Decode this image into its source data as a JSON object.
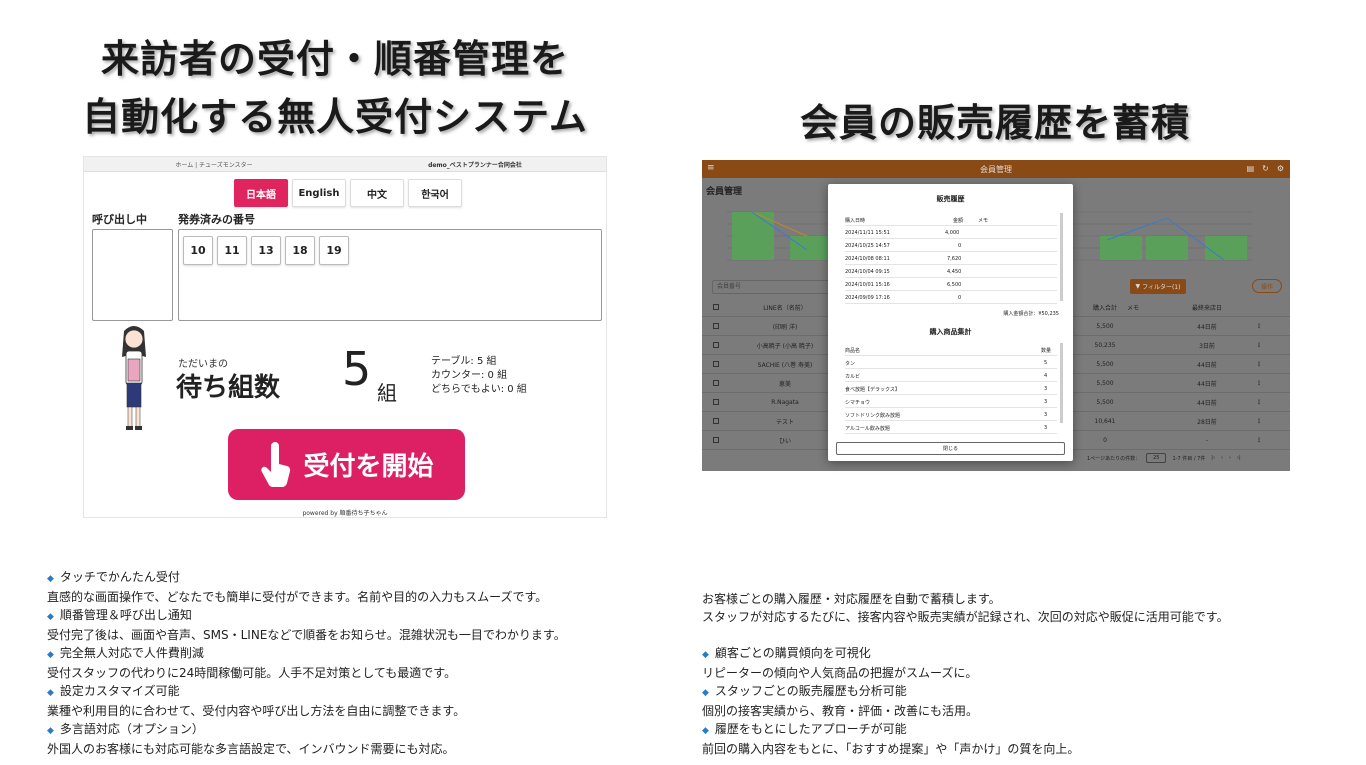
{
  "headings": {
    "left_line1": "来訪者の受付・順番管理を",
    "left_line2": "自動化する無人受付システム",
    "right": "会員の販売履歴を蓄積"
  },
  "kiosk": {
    "tab_home": "ホーム | チューズモンスター",
    "tab_demo": "demo_ベストプランナー合同会社",
    "languages": [
      "日本語",
      "English",
      "中文",
      "한국어"
    ],
    "calling_label": "呼び出し中",
    "issued_label": "発券済みの番号",
    "issued_numbers": [
      "10",
      "11",
      "13",
      "18",
      "19"
    ],
    "wait_sub": "ただいまの",
    "wait_title": "待ち組数",
    "wait_count": "5",
    "wait_unit": "組",
    "detail_table": "テーブル: 5 組",
    "detail_counter": "カウンター: 0 組",
    "detail_any": "どちらでもよい: 0 組",
    "start_button": "受付を開始",
    "powered": "powered by 順番待ち子ちゃん"
  },
  "admin": {
    "bar_title": "会員管理",
    "page_title": "会員管理",
    "search_placeholder": "会員番号",
    "filter_label": "フィルター(1)",
    "ops_label": "操作",
    "table_header": {
      "name": "LINE名（名前）",
      "total": "購入合計",
      "memo": "メモ",
      "last": "最終来店日"
    },
    "rows": [
      {
        "name": "(印刷 洋)",
        "total": "5,500",
        "last": "44日前"
      },
      {
        "name": "小高暁子 (小高 暁子)",
        "total": "50,235",
        "last": "3日前"
      },
      {
        "name": "SACHIE (八巻 寿美)",
        "total": "5,500",
        "last": "44日前"
      },
      {
        "name": "恵美",
        "total": "5,500",
        "last": "44日前"
      },
      {
        "name": "R.Nagata",
        "total": "5,500",
        "last": "44日前"
      },
      {
        "name": "テスト",
        "total": "10,641",
        "last": "28日前"
      },
      {
        "name": "ひい",
        "total": "0",
        "last": "-"
      }
    ],
    "footer_per_page": "1ページあたりの件数：",
    "footer_pp_value": "25",
    "footer_range": "1-7 件目 / 7件"
  },
  "modal": {
    "title": "販売履歴",
    "hist_header": {
      "date": "購入日時",
      "amount": "金額",
      "memo": "メモ"
    },
    "hist_rows": [
      {
        "date": "2024/11/11 15:51",
        "amount": "4,000"
      },
      {
        "date": "2024/10/25 14:57",
        "amount": "0"
      },
      {
        "date": "2024/10/08 08:11",
        "amount": "7,620"
      },
      {
        "date": "2024/10/04 09:15",
        "amount": "4,450"
      },
      {
        "date": "2024/10/01 15:16",
        "amount": "6,500"
      },
      {
        "date": "2024/09/09 17:16",
        "amount": "0"
      }
    ],
    "total": "購入金額合計：¥50,235",
    "prod_title": "購入商品集計",
    "prod_header": {
      "name": "商品名",
      "qty": "数量"
    },
    "prod_rows": [
      {
        "name": "タン",
        "qty": "5"
      },
      {
        "name": "カルビ",
        "qty": "4"
      },
      {
        "name": "食べ放題【デラックス】",
        "qty": "3"
      },
      {
        "name": "シマチョウ",
        "qty": "3"
      },
      {
        "name": "ソフトドリンク飲み放題",
        "qty": "3"
      },
      {
        "name": "アルコール飲み放題",
        "qty": "3"
      }
    ],
    "close": "閉じる"
  },
  "left_desc": [
    {
      "title": "タッチでかんたん受付",
      "body": "直感的な画面操作で、どなたでも簡単に受付ができます。名前や目的の入力もスムーズです。"
    },
    {
      "title": "順番管理＆呼び出し通知",
      "body": "受付完了後は、画面や音声、SMS・LINEなどで順番をお知らせ。混雑状況も一目でわかります。"
    },
    {
      "title": "完全無人対応で人件費削減",
      "body": "受付スタッフの代わりに24時間稼働可能。人手不足対策としても最適です。"
    },
    {
      "title": "設定カスタマイズ可能",
      "body": "業種や利用目的に合わせて、受付内容や呼び出し方法を自由に調整できます。"
    },
    {
      "title": "多言語対応（オプション）",
      "body": "外国人のお客様にも対応可能な多言語設定で、インバウンド需要にも対応。"
    }
  ],
  "right_intro": [
    "お客様ごとの購入履歴・対応履歴を自動で蓄積します。",
    "スタッフが対応するたびに、接客内容や販売実績が記録され、次回の対応や販促に活用可能です。"
  ],
  "right_desc": [
    {
      "title": "顧客ごとの購買傾向を可視化",
      "body": "リピーターの傾向や人気商品の把握がスムーズに。"
    },
    {
      "title": "スタッフごとの販売履歴も分析可能",
      "body": "個別の接客実績から、教育・評価・改善にも活用。"
    },
    {
      "title": "履歴をもとにしたアプローチが可能",
      "body": "前回の購入内容をもとに、「おすすめ提案」や「声かけ」の質を向上。"
    }
  ],
  "icons": {
    "bullet": "diamond-icon",
    "hand": "hand-tap-icon"
  },
  "colors": {
    "accent_pink": "#dd1f63",
    "admin_brown": "#8a4a16",
    "bullet_blue": "#2a7cc7"
  }
}
